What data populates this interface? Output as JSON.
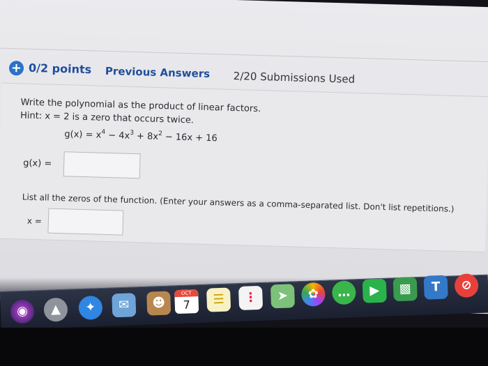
{
  "header": {
    "points": "0/2 points",
    "previous_answers": "Previous Answers",
    "submissions": "2/20 Submissions Used"
  },
  "question": {
    "prompt": "Write the polynomial as the product of linear factors.",
    "hint": "Hint:  x = 2  is a zero that occurs twice.",
    "function_name": "g(x) = ",
    "formula_terms": [
      "x",
      "4",
      " − 4x",
      "3",
      " + 8x",
      "2",
      " − 16x + 16"
    ],
    "answer_label": "g(x)  =",
    "answer_value": ""
  },
  "zeros_question": {
    "prompt": "List all the zeros of the function. (Enter your answers as a comma-separated list. Don't list repetitions.)",
    "answer_label": "x =",
    "answer_value": ""
  },
  "dock": {
    "calendar_month": "OCT",
    "calendar_day": "7",
    "icons": [
      "siri-icon",
      "launchpad-icon",
      "safari-icon",
      "mail-icon",
      "contacts-icon",
      "calendar-icon",
      "notes-icon",
      "reminders-icon",
      "maps-icon",
      "photos-icon",
      "messages-icon",
      "facetime-icon",
      "numbers-icon",
      "keynote-icon",
      "news-icon"
    ]
  },
  "colors": {
    "accent": "#1f4f9a",
    "plus_badge": "#2a72c8"
  }
}
